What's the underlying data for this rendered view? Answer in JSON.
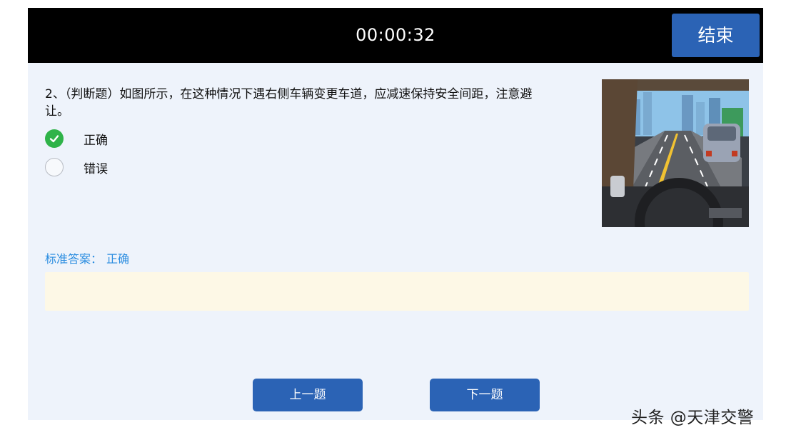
{
  "header": {
    "timer": "00:00:32",
    "end_label": "结束"
  },
  "question": {
    "text": "2、（判断题）如图所示，在这种情况下遇右侧车辆变更车道，应减速保持安全间距，注意避让。",
    "options": [
      {
        "label": "正确",
        "selected": true
      },
      {
        "label": "错误",
        "selected": false
      }
    ]
  },
  "answer": {
    "prefix": "标准答案：",
    "value": "正确"
  },
  "nav": {
    "prev_label": "上一题",
    "next_label": "下一题"
  },
  "watermark": "头条 @天津交警",
  "colors": {
    "accent": "#2b63b5",
    "check": "#2fb349",
    "answer_text": "#2b8de0",
    "explain_bg": "#fdf8e6"
  }
}
